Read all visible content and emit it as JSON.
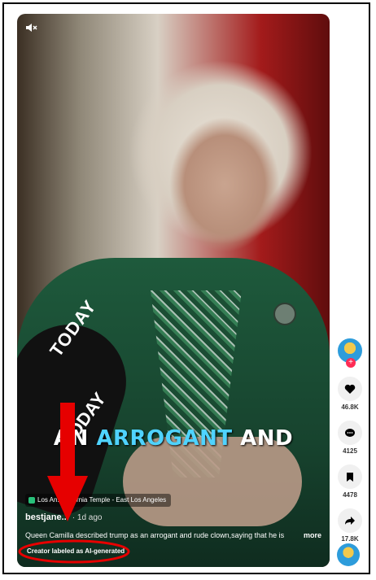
{
  "video": {
    "caption_prefix": "AN ",
    "caption_highlight": "ARROGANT",
    "caption_suffix": " AND",
    "mic_text": "TODAY"
  },
  "location": "Los An... alifornia Temple - East Los Angeles",
  "author": {
    "username": "bestjane...",
    "time": "· 1d ago"
  },
  "description": "Queen Camilla described trump as an arrogant and rude clown,saying that he is",
  "more_label": "more",
  "ai_label": "Creator labeled as AI-generated",
  "actions": {
    "likes": "46.8K",
    "comments": "4125",
    "saves": "4478",
    "shares": "17.8K"
  },
  "colors": {
    "follow": "#fe2c55",
    "highlight": "#4fd3ff",
    "annotation": "#e60000"
  },
  "icons": [
    "mute-icon",
    "heart-icon",
    "comment-icon",
    "bookmark-icon",
    "share-icon",
    "location-pin-icon"
  ]
}
